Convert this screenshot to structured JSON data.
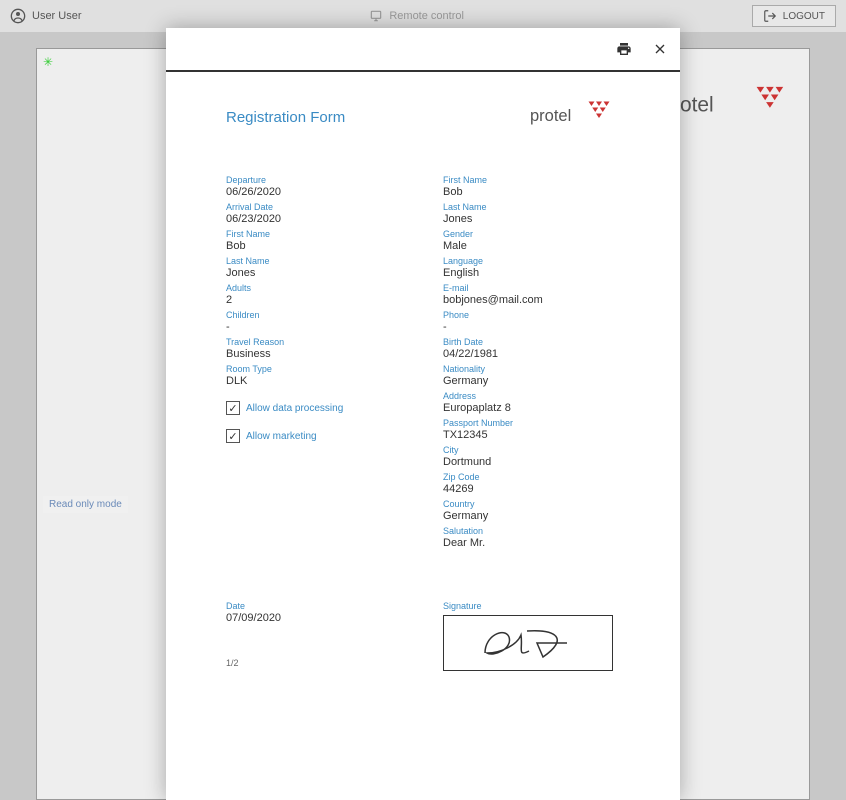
{
  "topbar": {
    "user_label": "User User",
    "center_label": "Remote control",
    "logout_label": "LOGOUT"
  },
  "background": {
    "logo_text": "rotel",
    "read_only_label": "Read only mode"
  },
  "modal": {
    "title": "Registration Form",
    "logo_text": "protel",
    "left_fields": [
      {
        "label": "Departure",
        "value": "06/26/2020"
      },
      {
        "label": "Arrival Date",
        "value": "06/23/2020"
      },
      {
        "label": "First Name",
        "value": "Bob"
      },
      {
        "label": "Last Name",
        "value": "Jones"
      },
      {
        "label": "Adults",
        "value": "2"
      },
      {
        "label": "Children",
        "value": "-"
      },
      {
        "label": "Travel Reason",
        "value": "Business"
      },
      {
        "label": "Room Type",
        "value": "DLK"
      }
    ],
    "checks": [
      {
        "label": "Allow data processing",
        "checked": true
      },
      {
        "label": "Allow marketing",
        "checked": true
      }
    ],
    "right_fields": [
      {
        "label": "First Name",
        "value": "Bob"
      },
      {
        "label": "Last Name",
        "value": "Jones"
      },
      {
        "label": "Gender",
        "value": "Male"
      },
      {
        "label": "Language",
        "value": "English"
      },
      {
        "label": "E-mail",
        "value": "bobjones@mail.com"
      },
      {
        "label": "Phone",
        "value": "-"
      },
      {
        "label": "Birth Date",
        "value": "04/22/1981"
      },
      {
        "label": "Nationality",
        "value": "Germany"
      },
      {
        "label": "Address",
        "value": "Europaplatz 8"
      },
      {
        "label": "Passport Number",
        "value": "TX12345"
      },
      {
        "label": "City",
        "value": "Dortmund"
      },
      {
        "label": "Zip Code",
        "value": "44269"
      },
      {
        "label": "Country",
        "value": "Germany"
      },
      {
        "label": "Salutation",
        "value": "Dear Mr."
      }
    ],
    "footer": {
      "date_label": "Date",
      "date_value": "07/09/2020",
      "signature_label": "Signature",
      "page_indicator": "1/2"
    }
  }
}
